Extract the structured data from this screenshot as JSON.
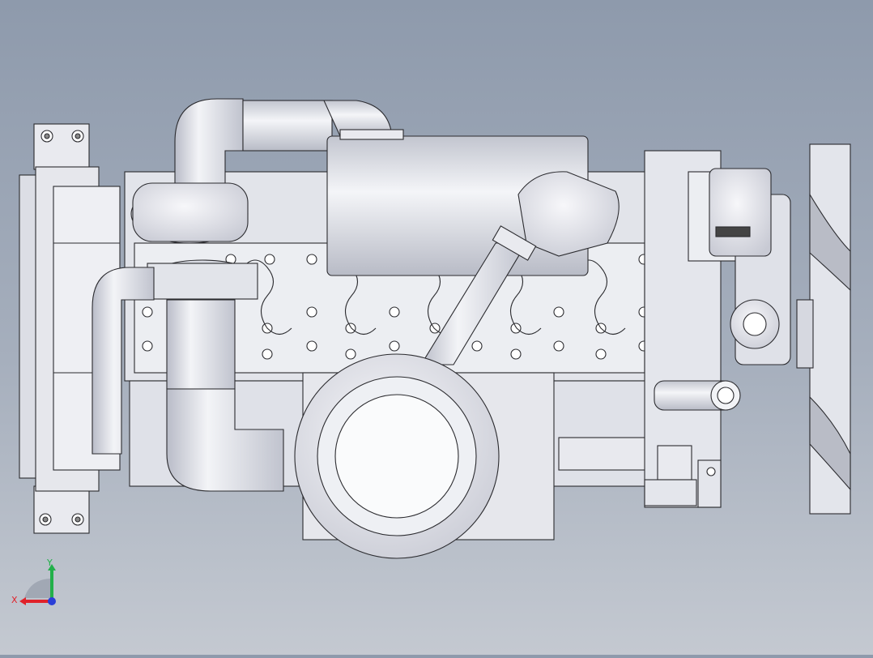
{
  "viewport": {
    "background_top": "#8e9aac",
    "background_bottom": "#c4c9d1",
    "part_fill": "#e9eaef",
    "part_shade": "#c9ccd6",
    "edge_color": "#2b2b2f"
  },
  "triad": {
    "x_label": "X",
    "y_label": "Y",
    "x_color": "#e0222a",
    "y_color": "#22b04a",
    "z_color": "#2a3fd8"
  }
}
